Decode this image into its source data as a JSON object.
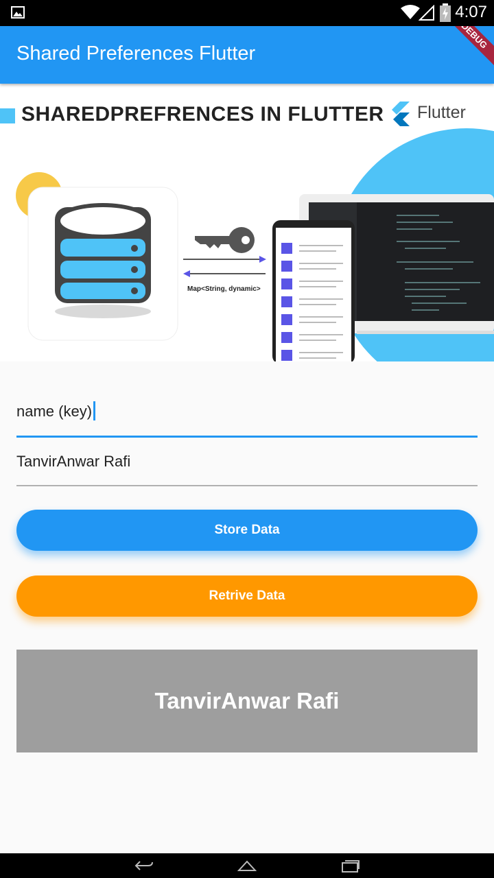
{
  "status_bar": {
    "time": "4:07",
    "icons": [
      "gallery-icon",
      "wifi-icon",
      "signal-icon",
      "battery-charging-icon"
    ]
  },
  "app_bar": {
    "title": "Shared Preferences Flutter",
    "debug_banner": "DEBUG"
  },
  "hero": {
    "title": "SHAREDPREFRENCES IN FLUTTER",
    "brand": "Flutter",
    "map_label": "Map<String, dynamic>",
    "icons": [
      "database-icon",
      "key-icon",
      "flutter-logo-icon"
    ],
    "colors": {
      "accent": "#4fc3f7",
      "yellow": "#f7c948",
      "purple": "#5a55e6"
    }
  },
  "form": {
    "key_value": "name (key)",
    "data_value": "TanvirAnwar Rafi"
  },
  "buttons": {
    "store_label": "Store Data",
    "retrive_label": "Retrive Data"
  },
  "result": {
    "text": "TanvirAnwar Rafi"
  },
  "colors": {
    "primary": "#2196f3",
    "orange": "#ff9800",
    "result_bg": "#9e9e9e"
  },
  "nav_bar": {
    "icons": [
      "back-icon",
      "home-icon",
      "recents-icon"
    ]
  }
}
